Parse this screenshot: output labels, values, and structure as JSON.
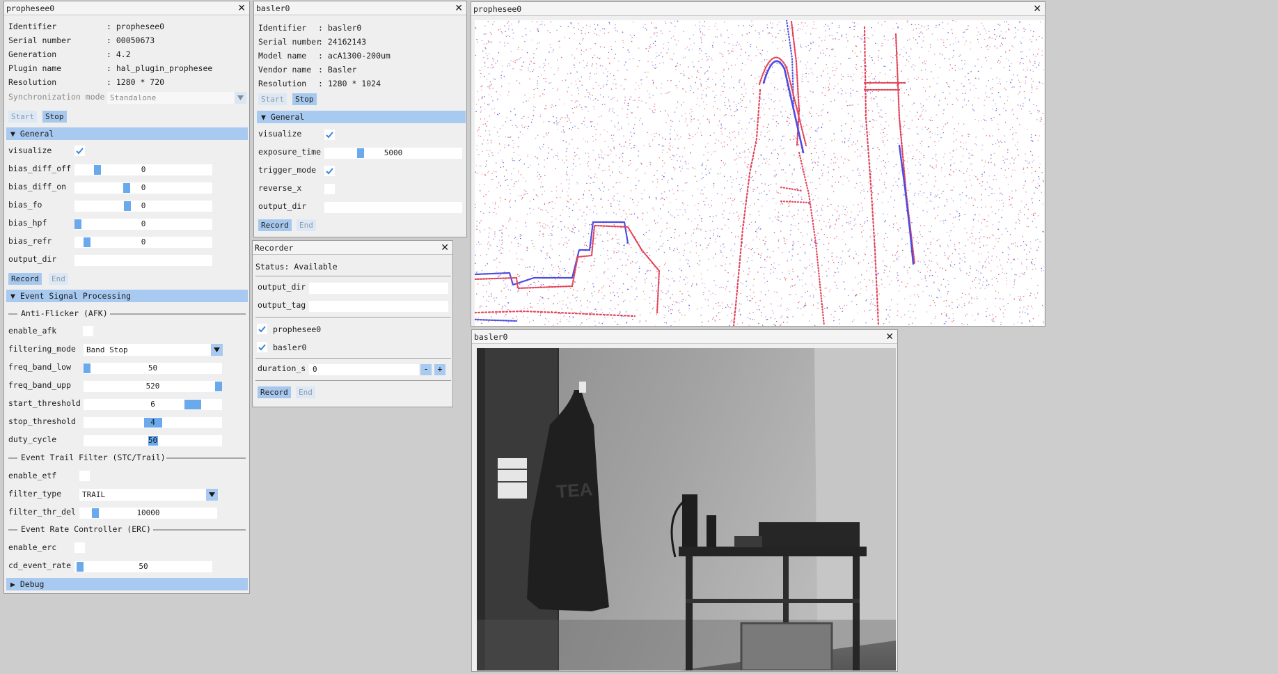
{
  "prophesee_panel": {
    "title": "prophesee0",
    "info": [
      {
        "label": "Identifier",
        "value": ": prophesee0"
      },
      {
        "label": "Serial number",
        "value": ": 00050673"
      },
      {
        "label": "Generation",
        "value": ": 4.2"
      },
      {
        "label": "Plugin name",
        "value": ": hal_plugin_prophesee"
      },
      {
        "label": "Resolution",
        "value": ": 1280 * 720"
      }
    ],
    "sync_label": "Synchronization mode",
    "sync_value": "Standalone",
    "start": "Start",
    "stop": "Stop",
    "general_header": "General",
    "visualize": "visualize",
    "biases": [
      {
        "label": "bias_diff_off",
        "value": "0",
        "level": 0.15
      },
      {
        "label": "bias_diff_on",
        "value": "0",
        "level": 0.37
      },
      {
        "label": "bias_fo",
        "value": "0",
        "level": 0.38
      },
      {
        "label": "bias_hpf",
        "value": "0",
        "level": 0.0
      },
      {
        "label": "bias_refr",
        "value": "0",
        "level": 0.07
      }
    ],
    "output_dir": "output_dir",
    "record": "Record",
    "end": "End",
    "esp_header": "Event Signal Processing",
    "afk_section": "Anti-Flicker (AFK)",
    "enable_afk": "enable_afk",
    "filtering_mode": "filtering_mode",
    "filtering_mode_value": "Band Stop",
    "afk_sliders": [
      {
        "label": "freq_band_low",
        "value": "50",
        "level": 0.0
      },
      {
        "label": "freq_band_upp",
        "value": "520",
        "level": 1.0
      },
      {
        "label": "start_threshold",
        "value": "6",
        "level": 0.83
      },
      {
        "label": "stop_threshold",
        "value": "4",
        "level": 0.5
      },
      {
        "label": "duty_cycle",
        "value": "50",
        "level": 0.5
      }
    ],
    "etf_section": "Event Trail Filter (STC/Trail)",
    "enable_etf": "enable_etf",
    "filter_type": "filter_type",
    "filter_type_value": "TRAIL",
    "filter_thr_del": "filter_thr_del",
    "filter_thr_del_value": "10000",
    "filter_thr_del_level": 0.0,
    "erc_section": "Event Rate Controller (ERC)",
    "enable_erc": "enable_erc",
    "cd_event_rate": "cd_event_rate",
    "cd_event_rate_value": "50",
    "cd_event_rate_level": 0.0,
    "debug_header": "Debug"
  },
  "basler_panel": {
    "title": "basler0",
    "info": [
      {
        "label": "Identifier",
        "value": ": basler0"
      },
      {
        "label": "Serial number",
        "value": ": 24162143"
      },
      {
        "label": "Model name",
        "value": ": acA1300-200um"
      },
      {
        "label": "Vendor name",
        "value": ": Basler"
      },
      {
        "label": "Resolution",
        "value": ": 1280 * 1024"
      }
    ],
    "start": "Start",
    "stop": "Stop",
    "general_header": "General",
    "visualize": "visualize",
    "exposure_time": "exposure_time",
    "exposure_value": "5000",
    "exposure_level": 0.25,
    "trigger_mode": "trigger_mode",
    "reverse_x": "reverse_x",
    "output_dir": "output_dir",
    "record": "Record",
    "end": "End"
  },
  "recorder_panel": {
    "title": "Recorder",
    "status": "Status: Available",
    "output_dir": "output_dir",
    "output_tag": "output_tag",
    "cameras": [
      "prophesee0",
      "basler0"
    ],
    "duration_label": "duration_s",
    "duration_value": "0",
    "minus": "-",
    "plus": "+",
    "record": "Record",
    "end": "End"
  },
  "event_view": {
    "title": "prophesee0"
  },
  "frame_view": {
    "title": "basler0",
    "jacket_text": "TEA"
  },
  "colors": {
    "accent": "#a8c9f0",
    "grab": "#6aa9ec",
    "event_pos": "#e0243c",
    "event_neg": "#2d2de0"
  }
}
